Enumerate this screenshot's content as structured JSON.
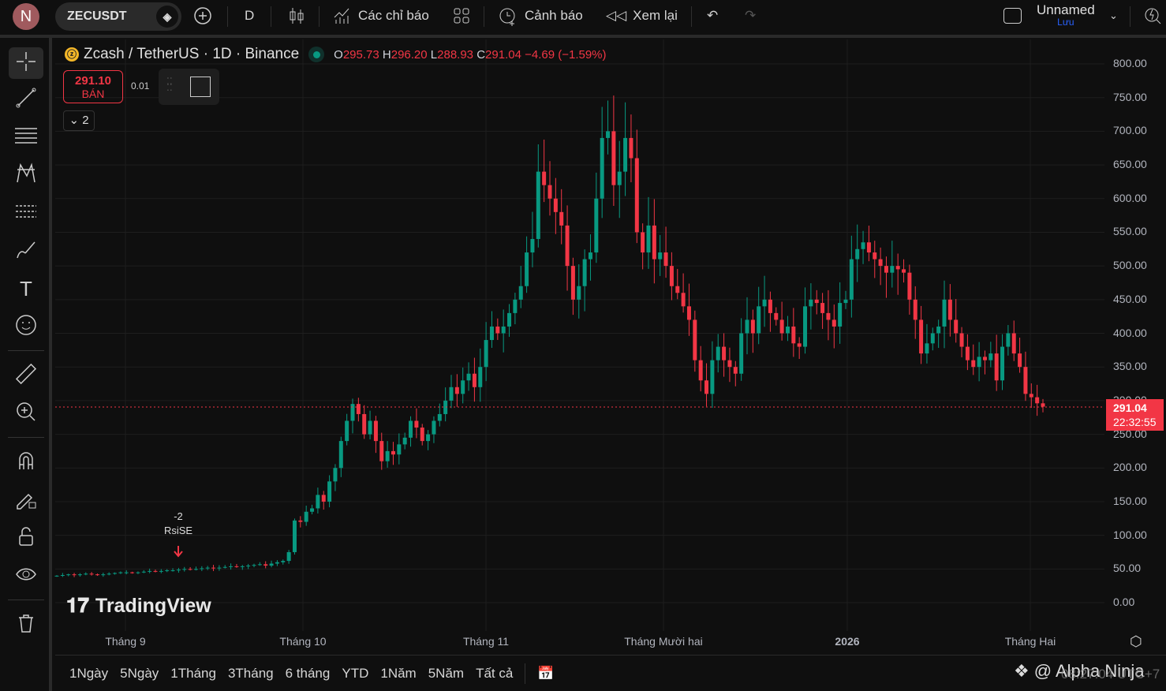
{
  "topbar": {
    "avatar": "N",
    "symbol": "ZECUSDT",
    "interval": "D",
    "indicators": "Các chỉ báo",
    "alerts": "Cảnh báo",
    "replay": "Xem lại",
    "layout_name": "Unnamed",
    "save": "Lưu"
  },
  "legend": {
    "title": "Zcash / TetherUS · 1D · Binance",
    "o_label": "O",
    "o": "295.73",
    "h_label": "H",
    "h": "296.20",
    "l_label": "L",
    "l": "288.93",
    "c_label": "C",
    "c": "291.04",
    "change": "−4.69 (−1.59%)"
  },
  "trade": {
    "sell_price": "291.10",
    "sell_label": "BÁN",
    "spread": "0.01",
    "collapse": "2"
  },
  "annotation": {
    "value": "-2",
    "label": "RsiSE"
  },
  "watermark": "TradingView",
  "price_tag": {
    "price": "291.04",
    "countdown": "22:32:55"
  },
  "bottom": {
    "ranges": [
      "1Ngày",
      "5Ngày",
      "1Tháng",
      "3Tháng",
      "6 tháng",
      "YTD",
      "1Năm",
      "5Năm",
      "Tất cả"
    ],
    "credit": "@ Alpha Ninja",
    "time": "08:27:04 UTC+7"
  },
  "colors": {
    "up": "#089981",
    "down": "#f23645",
    "bg": "#0f0f0f",
    "grid": "#1e1e1e"
  },
  "chart_data": {
    "type": "candlestick",
    "title": "Zcash / TetherUS · 1D · Binance",
    "ylim": [
      0,
      800
    ],
    "y_ticks": [
      "800.00",
      "750.00",
      "700.00",
      "650.00",
      "600.00",
      "550.00",
      "500.00",
      "450.00",
      "400.00",
      "350.00",
      "300.00",
      "250.00",
      "200.00",
      "150.00",
      "100.00",
      "50.00",
      "0.00"
    ],
    "x_ticks": [
      "Tháng 9",
      "Tháng 10",
      "Tháng 11",
      "Tháng Mười hai",
      "2026",
      "Tháng Hai"
    ],
    "current_price": 291.04,
    "closes": [
      40,
      41,
      42,
      41,
      42,
      43,
      42,
      41,
      42,
      43,
      44,
      45,
      45,
      44,
      45,
      46,
      47,
      46,
      47,
      48,
      48,
      49,
      50,
      49,
      50,
      51,
      52,
      51,
      52,
      53,
      54,
      53,
      54,
      55,
      56,
      57,
      55,
      58,
      60,
      62,
      75,
      122,
      120,
      135,
      140,
      160,
      150,
      180,
      200,
      240,
      270,
      295,
      280,
      250,
      270,
      240,
      210,
      225,
      220,
      235,
      245,
      270,
      260,
      240,
      250,
      270,
      280,
      300,
      320,
      310,
      330,
      340,
      320,
      350,
      390,
      410,
      400,
      410,
      430,
      450,
      470,
      520,
      540,
      640,
      620,
      600,
      580,
      560,
      500,
      450,
      470,
      510,
      520,
      600,
      690,
      700,
      620,
      640,
      690,
      660,
      550,
      520,
      560,
      510,
      520,
      500,
      470,
      460,
      440,
      420,
      360,
      330,
      310,
      360,
      380,
      360,
      350,
      340,
      400,
      420,
      400,
      440,
      450,
      430,
      420,
      400,
      410,
      385,
      380,
      440,
      450,
      445,
      430,
      420,
      410,
      445,
      450,
      510,
      525,
      535,
      520,
      510,
      500,
      490,
      500,
      495,
      490,
      450,
      420,
      370,
      385,
      400,
      410,
      450,
      420,
      400,
      380,
      360,
      350,
      365,
      360,
      370,
      330,
      380,
      400,
      370,
      350,
      310,
      305,
      296,
      291.04
    ]
  }
}
